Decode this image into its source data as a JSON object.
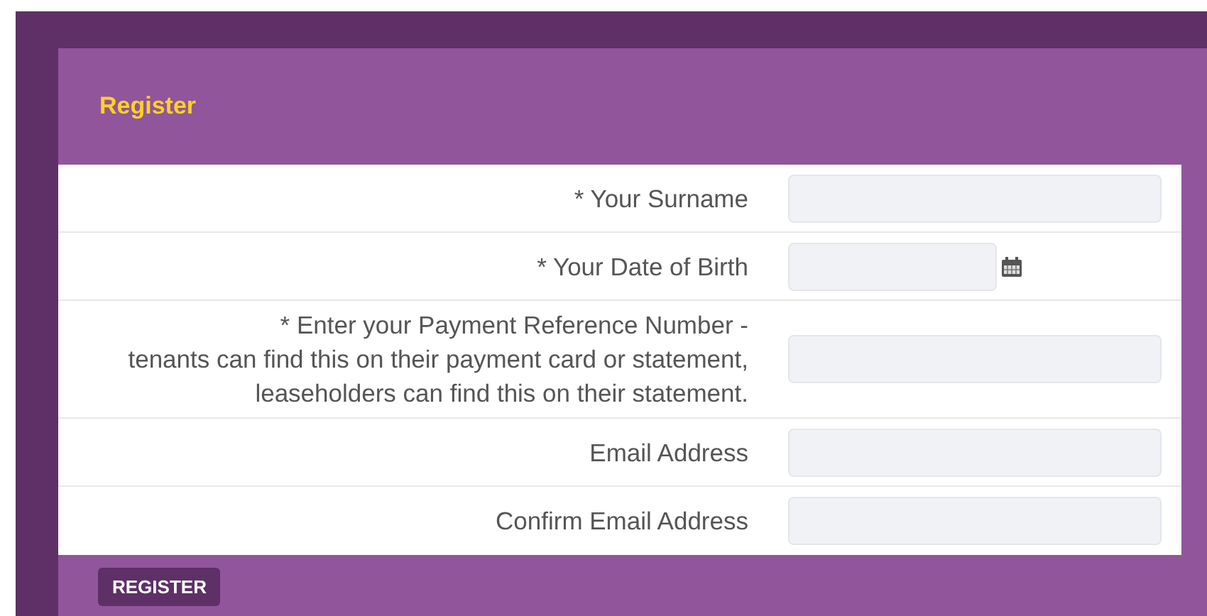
{
  "panel": {
    "title": "Register"
  },
  "fields": [
    {
      "label_lines": [
        "* Your Surname"
      ],
      "kind": "text"
    },
    {
      "label_lines": [
        "* Your Date of Birth"
      ],
      "kind": "date"
    },
    {
      "label_lines": [
        "* Enter your Payment Reference Number -",
        "tenants can find this on their payment card or statement,",
        "leaseholders can find this on their statement."
      ],
      "kind": "text"
    },
    {
      "label_lines": [
        "Email Address"
      ],
      "kind": "text"
    },
    {
      "label_lines": [
        "Confirm Email Address"
      ],
      "kind": "text"
    }
  ],
  "submit_button": {
    "label": "REGISTER"
  }
}
